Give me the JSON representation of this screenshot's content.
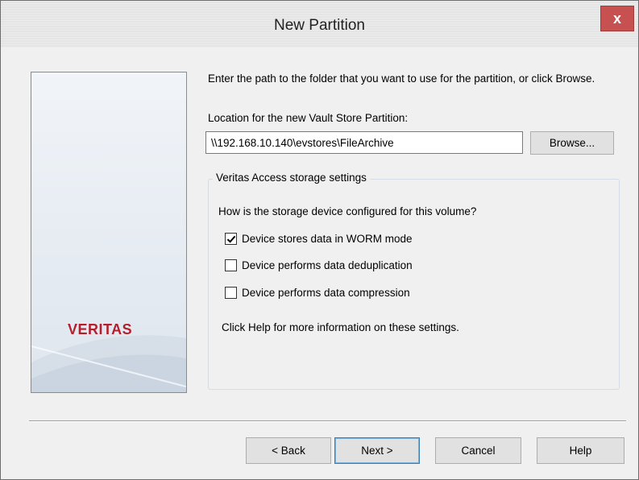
{
  "window": {
    "title": "New Partition",
    "close_glyph": "x"
  },
  "banner": {
    "logo_text": "VERITAS",
    "brand_color": "#b3202d"
  },
  "form": {
    "intro_text": "Enter the path to the folder that you want to use for the partition, or click Browse.",
    "location_label": "Location for the new Vault Store Partition:",
    "location_value": "\\\\192.168.10.140\\evstores\\FileArchive",
    "browse_label": "Browse..."
  },
  "storage": {
    "group_label": "Veritas Access storage settings",
    "question": "How is the storage device configured for this volume?",
    "options": [
      {
        "label": "Device stores data in WORM mode",
        "checked": true
      },
      {
        "label": "Device performs data deduplication",
        "checked": false
      },
      {
        "label": "Device performs data compression",
        "checked": false
      }
    ],
    "help_info": "Click Help for more information on these settings."
  },
  "buttons": {
    "back": "< Back",
    "next": "Next >",
    "cancel": "Cancel",
    "help": "Help"
  }
}
